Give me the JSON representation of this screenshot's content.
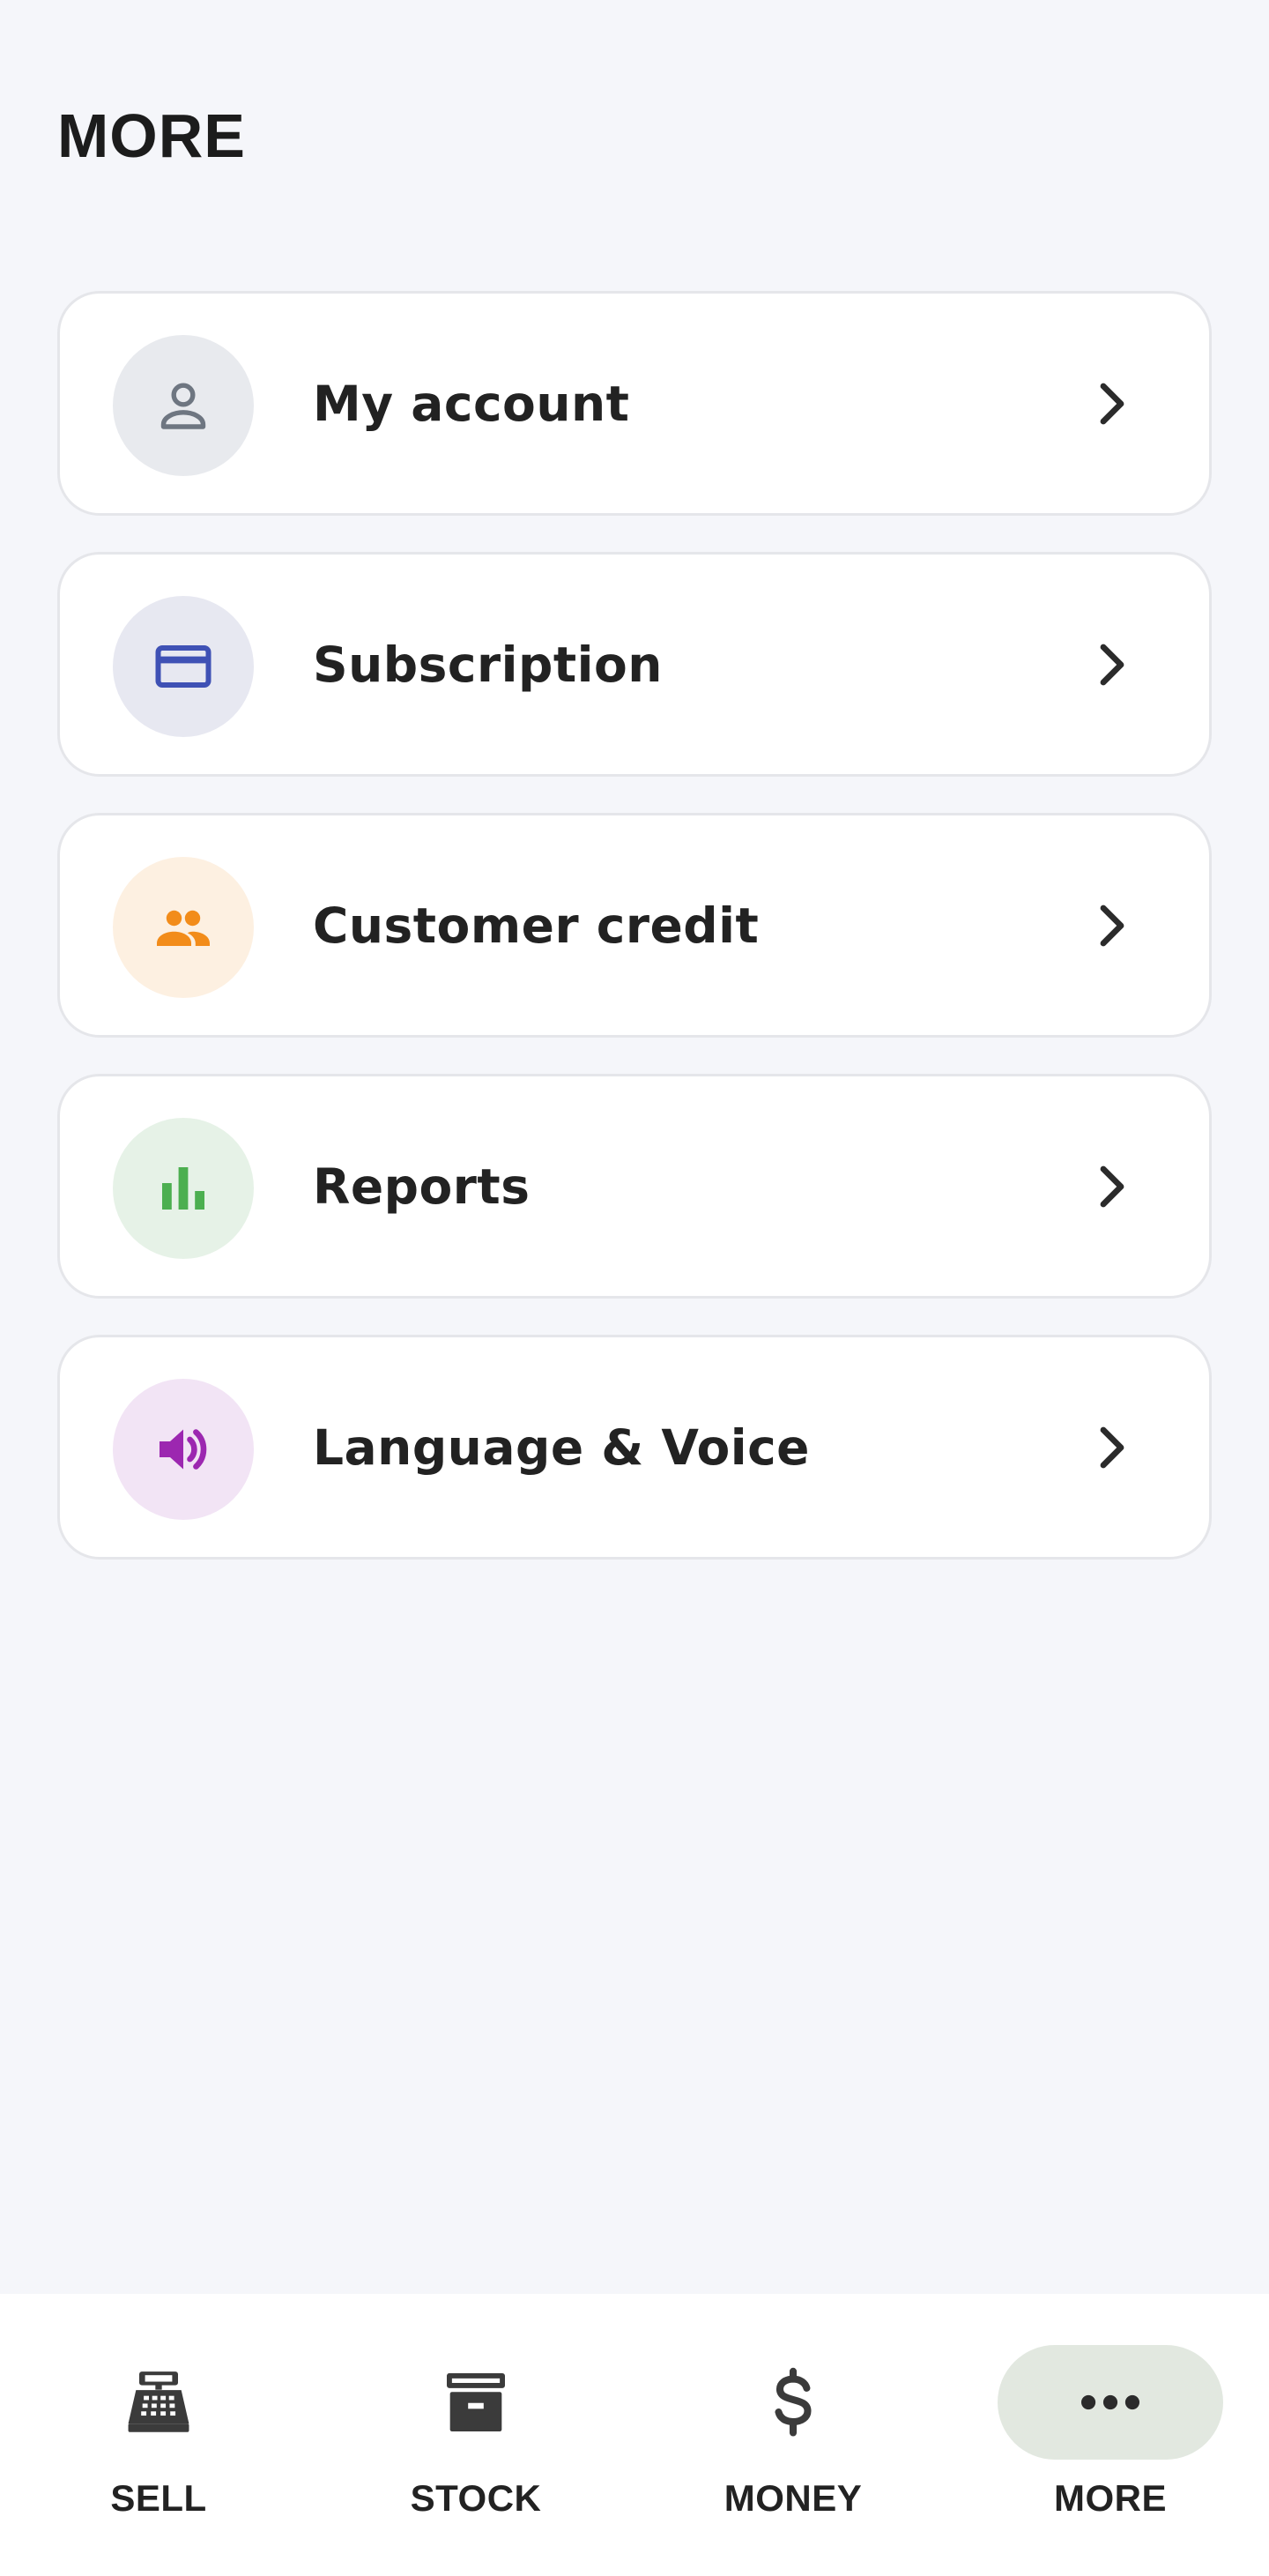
{
  "page": {
    "title": "MORE"
  },
  "menu": {
    "items": [
      {
        "label": "My account",
        "icon": "person-icon",
        "icon_bg": "#e8eaee",
        "icon_color": "#6e7681"
      },
      {
        "label": "Subscription",
        "icon": "credit-card-icon",
        "icon_bg": "#e7e8f1",
        "icon_color": "#3f51b5"
      },
      {
        "label": "Customer credit",
        "icon": "people-icon",
        "icon_bg": "#fdf0e1",
        "icon_color": "#f28c1a"
      },
      {
        "label": "Reports",
        "icon": "bar-chart-icon",
        "icon_bg": "#e6f2e7",
        "icon_color": "#4caf50"
      },
      {
        "label": "Language & Voice",
        "icon": "speaker-icon",
        "icon_bg": "#f2e4f5",
        "icon_color": "#9c27b0"
      }
    ]
  },
  "bottom_nav": {
    "items": [
      {
        "label": "SELL",
        "icon": "cash-register-icon",
        "active": false
      },
      {
        "label": "STOCK",
        "icon": "archive-box-icon",
        "active": false
      },
      {
        "label": "MONEY",
        "icon": "dollar-icon",
        "active": false
      },
      {
        "label": "MORE",
        "icon": "more-dots-icon",
        "active": true
      }
    ],
    "active_bg": "#e2e8e0"
  }
}
